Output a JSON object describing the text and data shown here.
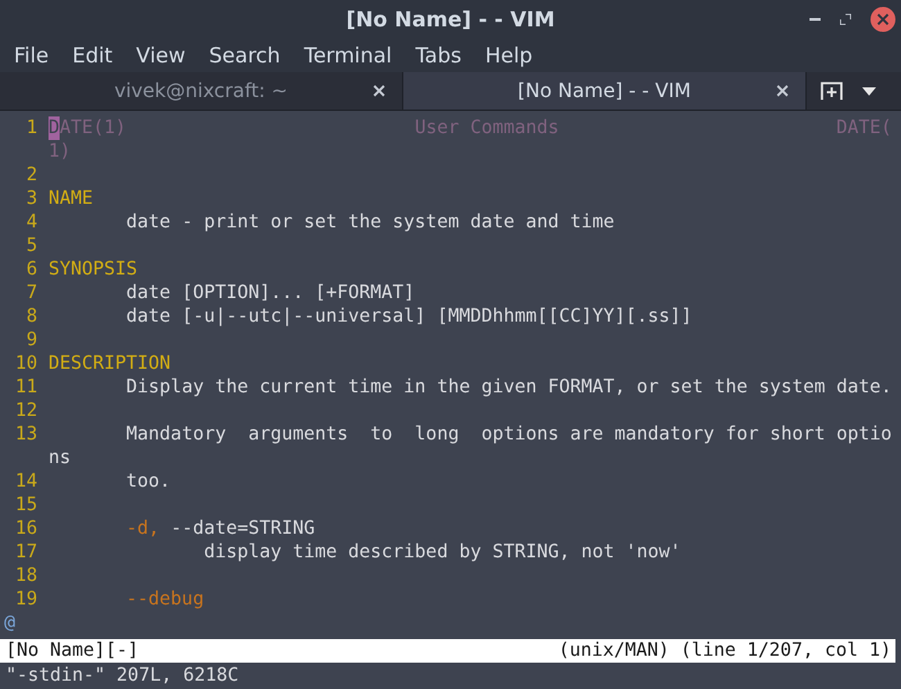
{
  "window": {
    "title": "[No Name] - - VIM"
  },
  "menu": [
    "File",
    "Edit",
    "View",
    "Search",
    "Terminal",
    "Tabs",
    "Help"
  ],
  "tabs": [
    {
      "label": "vivek@nixcraft: ~",
      "selected": false
    },
    {
      "label": "[No Name] - - VIM",
      "selected": true
    }
  ],
  "editor": {
    "rows": [
      {
        "number": "1",
        "segments": [
          {
            "kind": "cursor",
            "text": "D"
          },
          {
            "kind": "title",
            "text": "ATE(1)                          User Commands                         DATE("
          }
        ]
      },
      {
        "segments": [
          {
            "kind": "title",
            "text": "1)"
          }
        ]
      },
      {
        "number": "2",
        "segments": []
      },
      {
        "number": "3",
        "segments": [
          {
            "kind": "heading",
            "text": "NAME"
          }
        ]
      },
      {
        "number": "4",
        "segments": [
          {
            "kind": "text",
            "text": "       date - print or set the system date and time"
          }
        ]
      },
      {
        "number": "5",
        "segments": []
      },
      {
        "number": "6",
        "segments": [
          {
            "kind": "heading",
            "text": "SYNOPSIS"
          }
        ]
      },
      {
        "number": "7",
        "segments": [
          {
            "kind": "text",
            "text": "       date [OPTION]... [+FORMAT]"
          }
        ]
      },
      {
        "number": "8",
        "segments": [
          {
            "kind": "text",
            "text": "       date [-u|--utc|--universal] [MMDDhhmm[[CC]YY][.ss]]"
          }
        ]
      },
      {
        "number": "9",
        "segments": []
      },
      {
        "number": "10",
        "segments": [
          {
            "kind": "heading",
            "text": "DESCRIPTION"
          }
        ]
      },
      {
        "number": "11",
        "segments": [
          {
            "kind": "text",
            "text": "       Display the current time in the given FORMAT, or set the system date."
          }
        ]
      },
      {
        "number": "12",
        "segments": []
      },
      {
        "number": "13",
        "segments": [
          {
            "kind": "text",
            "text": "       Mandatory  arguments  to  long  options are mandatory for short optio"
          }
        ]
      },
      {
        "segments": [
          {
            "kind": "text",
            "text": "ns"
          }
        ]
      },
      {
        "number": "14",
        "segments": [
          {
            "kind": "text",
            "text": "       too."
          }
        ]
      },
      {
        "number": "15",
        "segments": []
      },
      {
        "number": "16",
        "segments": [
          {
            "kind": "option",
            "text": "-d,",
            "indented": true
          },
          {
            "kind": "text",
            "text": " --date=STRING"
          }
        ]
      },
      {
        "number": "17",
        "segments": [
          {
            "kind": "text",
            "text": "              display time described by STRING, not 'now'"
          }
        ]
      },
      {
        "number": "18",
        "segments": []
      },
      {
        "number": "19",
        "segments": [
          {
            "kind": "option",
            "text": "--debug",
            "indented": true
          }
        ]
      }
    ],
    "overflow_marker": "@"
  },
  "status_line": {
    "left": "[No Name][-]",
    "right": "(unix/MAN) (line 1/207, col 1)"
  },
  "command_line": "\"-stdin-\" 207L, 6218C"
}
